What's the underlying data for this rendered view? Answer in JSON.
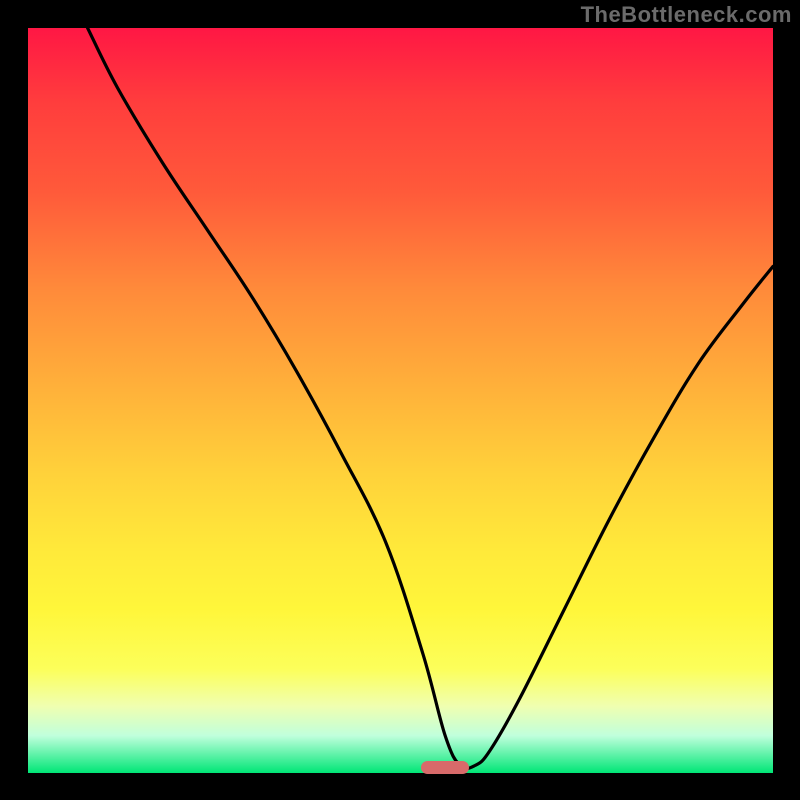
{
  "watermark": "TheBottleneck.com",
  "colors": {
    "page_bg": "#000000",
    "gradient_top": "#ff1744",
    "gradient_mid": "#ffd23a",
    "gradient_bottom": "#00e676",
    "curve_stroke": "#000000",
    "marker": "#d86a6a",
    "watermark": "#6b6b6b"
  },
  "chart_data": {
    "type": "line",
    "title": "",
    "xlabel": "",
    "ylabel": "",
    "xlim": [
      0,
      100
    ],
    "ylim": [
      0,
      100
    ],
    "legend": false,
    "grid": false,
    "series": [
      {
        "name": "bottleneck-curve",
        "x": [
          8,
          12,
          18,
          24,
          30,
          36,
          42,
          48,
          53,
          56,
          58,
          60,
          62,
          66,
          72,
          78,
          84,
          90,
          96,
          100
        ],
        "values": [
          100,
          92,
          82,
          73,
          64,
          54,
          43,
          31,
          16,
          5,
          1,
          1,
          3,
          10,
          22,
          34,
          45,
          55,
          63,
          68
        ]
      }
    ],
    "marker": {
      "x_pct_range": [
        55.5,
        62
      ],
      "y_pct": 0.5
    },
    "background_gradient": "vertical red-to-green"
  }
}
